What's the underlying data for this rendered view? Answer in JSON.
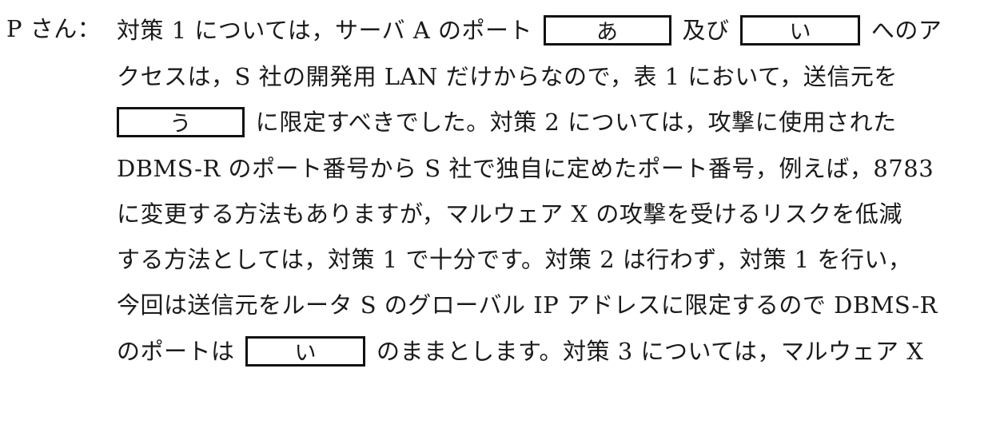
{
  "speaker": "P さん：",
  "lines": [
    {
      "pre": "対策 1 については，サーバ A のポート",
      "blank1": "あ",
      "mid": "及び",
      "blank2": "い",
      "post": "へのア"
    },
    {
      "text": "クセスは，S 社の開発用 LAN だけからなので，表 1 において，送信元を"
    },
    {
      "blank": "う",
      "post": "に限定すべきでした。対策 2 については，攻撃に使用された"
    },
    {
      "text": "DBMS-R のポート番号から S 社で独自に定めたポート番号，例えば，8783"
    },
    {
      "text": "に変更する方法もありますが，マルウェア X の攻撃を受けるリスクを低減"
    },
    {
      "text": "する方法としては，対策 1 で十分です。対策 2 は行わず，対策 1 を行い，"
    },
    {
      "text": "今回は送信元をルータ S のグローバル IP アドレスに限定するので DBMS-R"
    },
    {
      "pre": "のポートは",
      "blank": "い",
      "post": "のままとします。対策 3 については，マルウェア X"
    }
  ]
}
